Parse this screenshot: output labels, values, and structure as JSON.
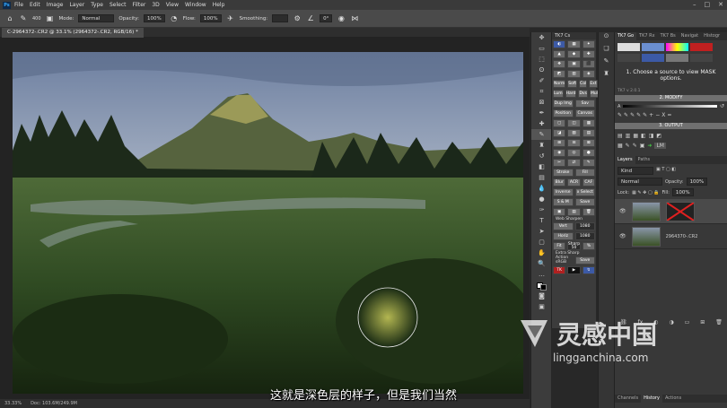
{
  "menubar": {
    "items": [
      "File",
      "Edit",
      "Image",
      "Layer",
      "Type",
      "Select",
      "Filter",
      "3D",
      "View",
      "Window",
      "Help"
    ]
  },
  "options": {
    "size": "400",
    "mode_label": "Mode:",
    "mode": "Normal",
    "opacity_label": "Opacity:",
    "opacity": "100%",
    "flow_label": "Flow:",
    "flow": "100%",
    "smoothing_label": "Smoothing:",
    "angle": "0°"
  },
  "document": {
    "tab_title": "C-2964372-.CR2 @ 33.1% (2964372-.CR2, RGB/16) *"
  },
  "status": {
    "zoom": "33.33%",
    "doc": "Doc: 103.6M/249.9M"
  },
  "tk7": {
    "title": "TK7 Cs",
    "r1": [
      "Norm",
      "Soft",
      "Col",
      "Ext"
    ],
    "r2": [
      "Lum",
      "Hard",
      "Dvs",
      "Mult"
    ],
    "b1": [
      "Dup Img",
      "Sav"
    ],
    "b2": [
      "Position",
      "Canvas"
    ],
    "b3": [
      "Stroke",
      "Fill"
    ],
    "b4": [
      "Blur",
      "ACR",
      "CAF"
    ],
    "b5": [
      "Inverse",
      "x Select"
    ],
    "b6": [
      "S & M",
      "Save"
    ],
    "web": "Web Sharpen",
    "vert": "Vert",
    "vert_v": "1080",
    "horiz": "Horiz",
    "horiz_v": "1080",
    "fit": "Fit",
    "sharp_l": "Sharp",
    "sharp_v": "50",
    "pct": "%",
    "extra": "Extra Sharp",
    "action": "Action",
    "srgb": "sRGB",
    "save": "Save",
    "bottom": [
      "TK",
      "▶",
      "↯"
    ]
  },
  "panel": {
    "tabs": [
      "TK7 Go",
      "TK7 Rx",
      "TK7 Bs",
      "Navigat",
      "Histogr"
    ],
    "msg": "1. Choose a source to view MASK options.",
    "version": "TK7 v 2.0.1",
    "modify": "2. MODIFY",
    "output": "3. OUTPUT",
    "lm": "LM",
    "x": "X",
    "eq": "="
  },
  "layers": {
    "tabs": [
      "Layers",
      "Paths"
    ],
    "kind": "Kind",
    "blend": "Normal",
    "opacity_l": "Opacity:",
    "opacity": "100%",
    "lock": "Lock:",
    "fill_l": "Fill:",
    "fill": "100%",
    "items": [
      {
        "name": ""
      },
      {
        "name": "2964370-.CR2"
      }
    ],
    "bottom_tabs": [
      "Channels",
      "History",
      "Actions"
    ]
  },
  "subtitle": "这就是深色层的样子，但是我们当然",
  "watermark": {
    "brand": "灵感中国",
    "url": "lingganchina.com"
  },
  "colors": {
    "accent": "#31a8ff",
    "bg": "#282828"
  }
}
